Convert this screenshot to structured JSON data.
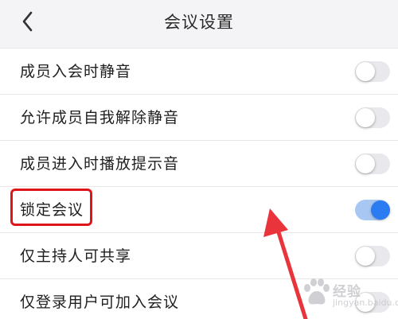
{
  "header": {
    "title": "会议设置",
    "back_icon": "chevron-left-icon"
  },
  "settings": [
    {
      "label": "成员入会时静音",
      "enabled": false
    },
    {
      "label": "允许成员自我解除静音",
      "enabled": false
    },
    {
      "label": "成员进入时播放提示音",
      "enabled": false
    },
    {
      "label": "锁定会议",
      "enabled": true
    },
    {
      "label": "仅主持人可共享",
      "enabled": false
    },
    {
      "label": "仅登录用户可加入会议",
      "enabled": false
    }
  ],
  "colors": {
    "accent": "#2a7cf0",
    "highlight": "#e0151b",
    "annotation_arrow": "#e8343a"
  },
  "watermark": {
    "text": "经验",
    "sub": "jingyan.baidu.com"
  }
}
